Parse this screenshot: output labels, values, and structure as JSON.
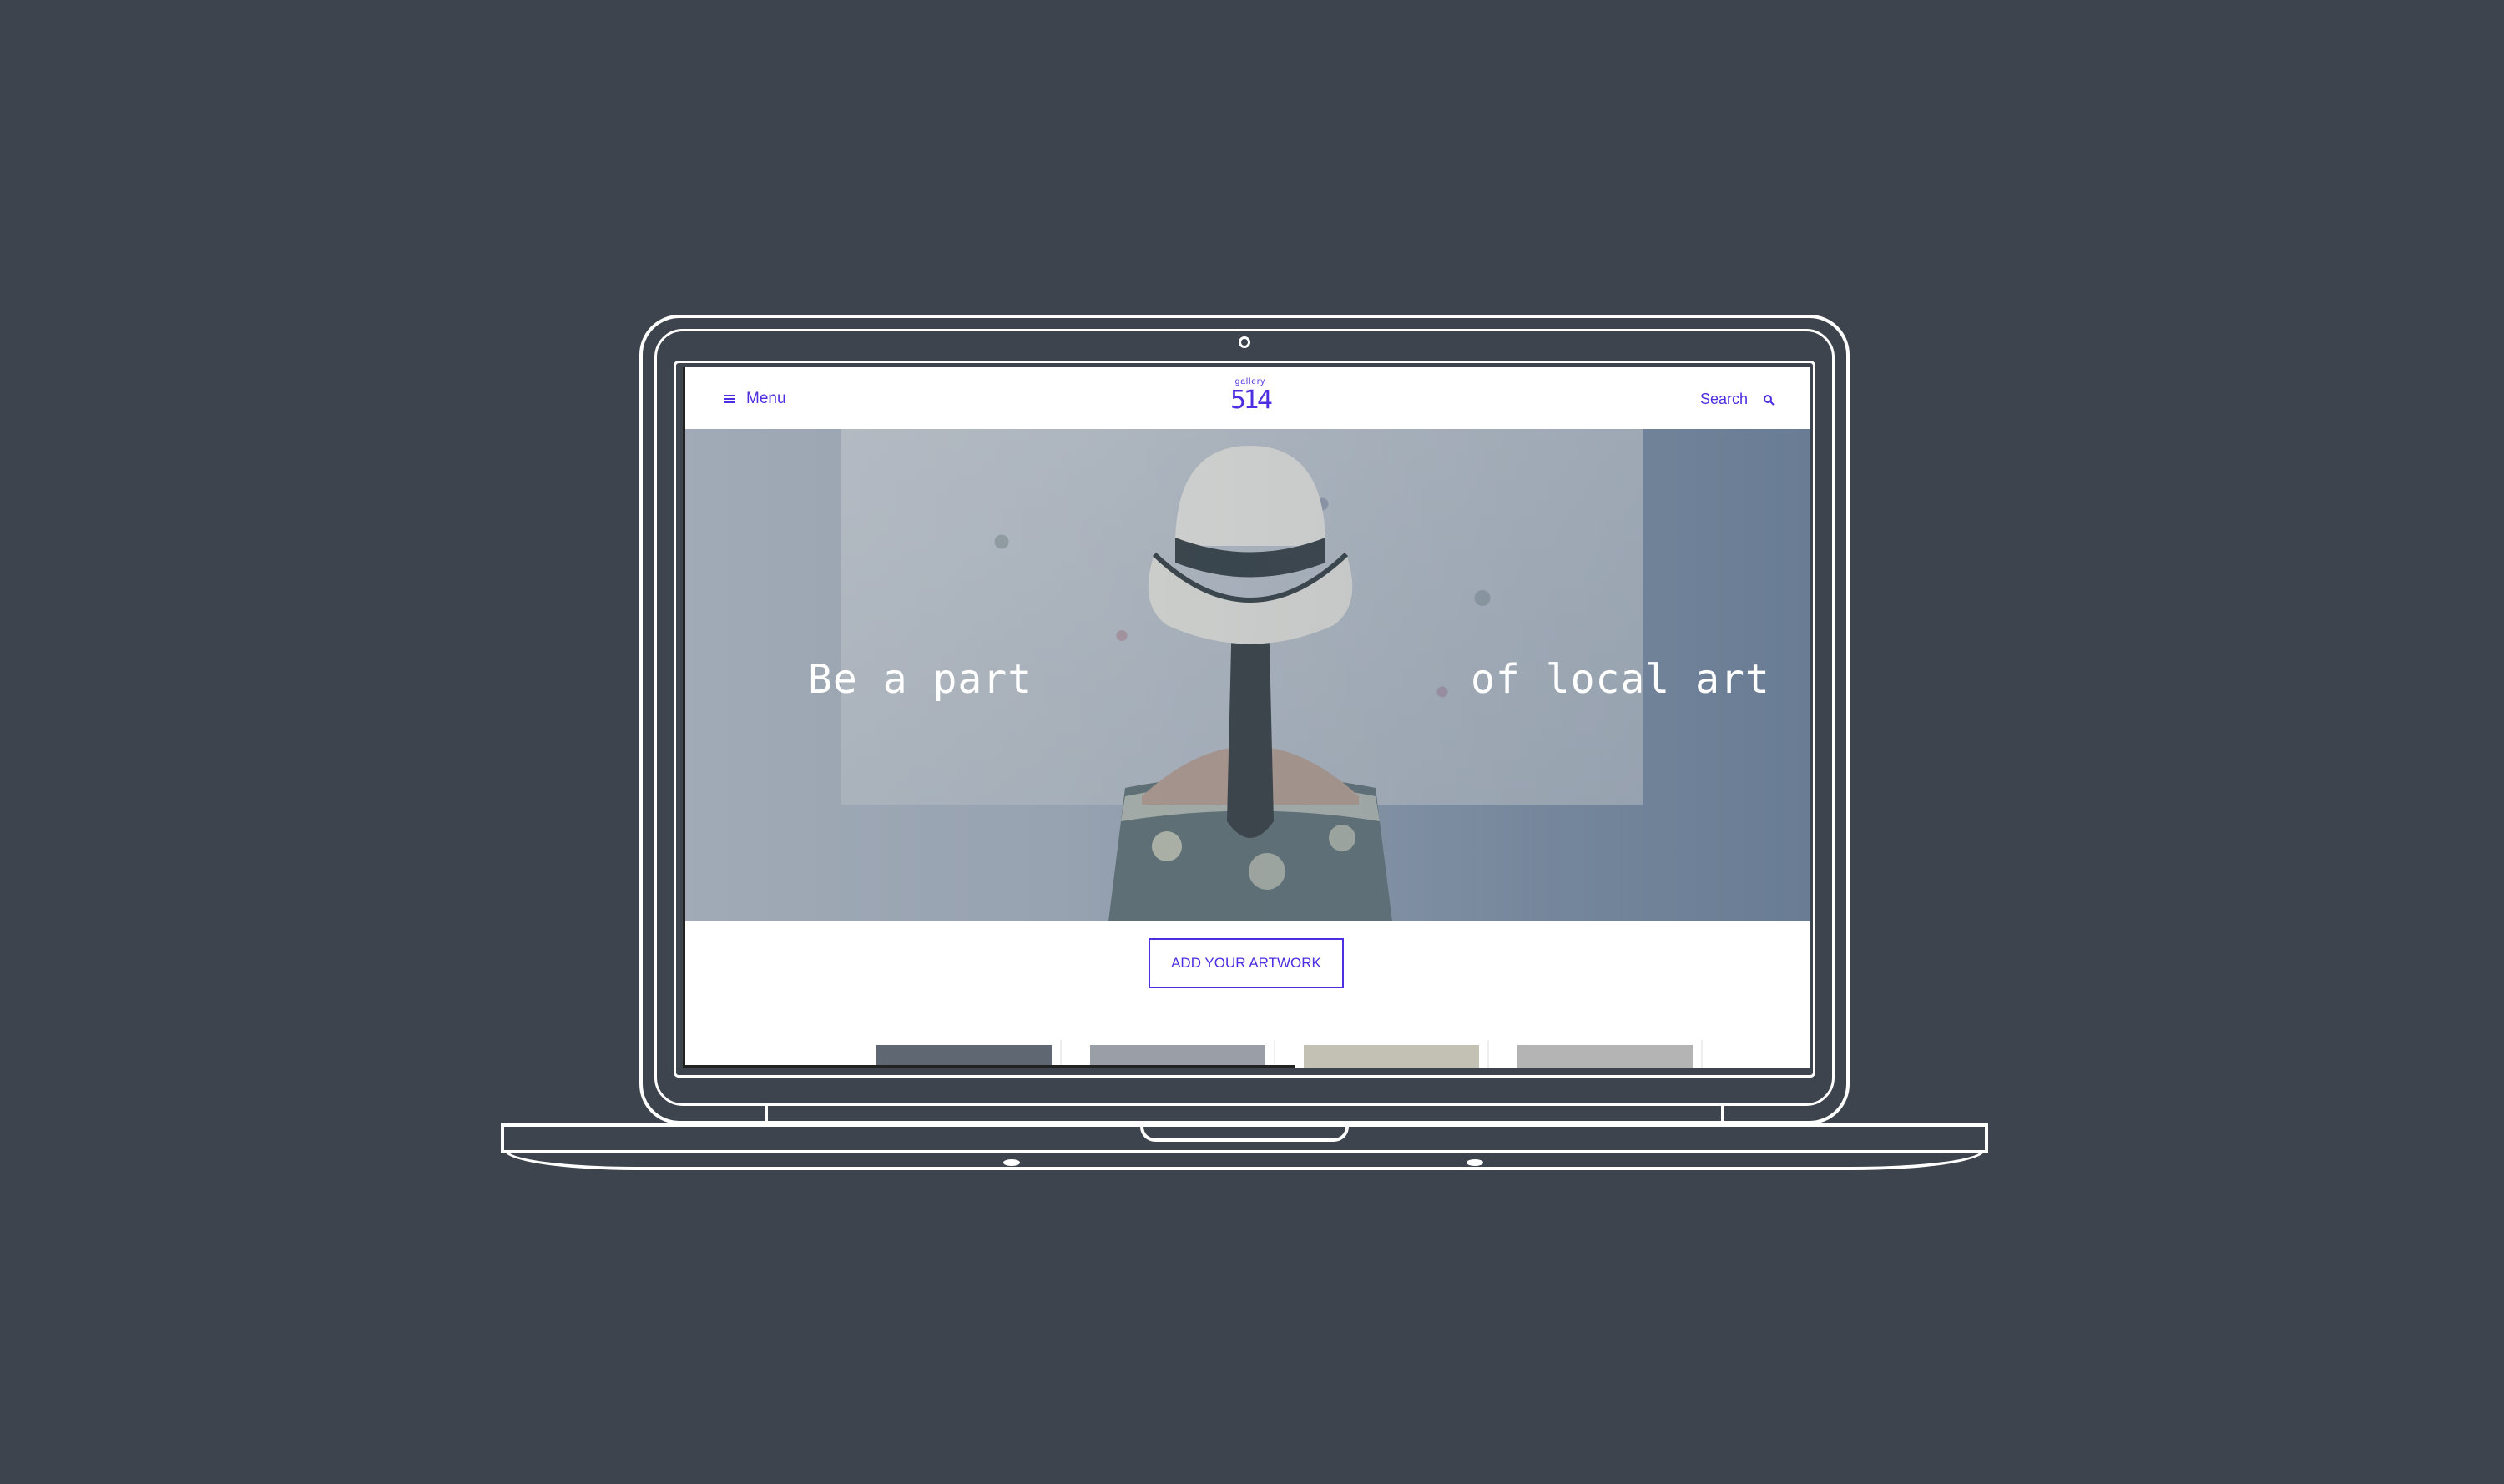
{
  "colors": {
    "background": "#3d444d",
    "accent": "#4d2ee0",
    "outline": "#ffffff"
  },
  "navbar": {
    "menu_label": "Menu",
    "menu_icon": "hamburger-icon",
    "logo_small": "gallery",
    "logo_big": "514",
    "search_label": "Search",
    "search_icon": "search-icon"
  },
  "hero": {
    "text_left": "Be a part",
    "text_right": "of local art"
  },
  "cta": {
    "label": "ADD YOUR ARTWORK"
  },
  "thumbnails": [
    {
      "name": "artwork-thumb-1",
      "color": "#5f6872"
    },
    {
      "name": "artwork-thumb-2",
      "color": "#9a9ea6"
    },
    {
      "name": "artwork-thumb-3",
      "color": "#c3c0b4"
    },
    {
      "name": "artwork-thumb-4",
      "color": "#b4b4b4"
    }
  ]
}
